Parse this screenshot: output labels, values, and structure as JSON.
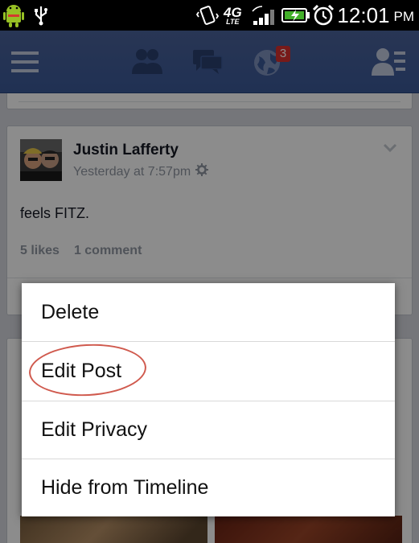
{
  "status_bar": {
    "time": "12:01",
    "ampm": "PM",
    "network_label": "4G",
    "network_sub": "LTE",
    "icons": [
      "android-icon",
      "usb-icon",
      "vibrate-icon",
      "signal-bars-icon",
      "battery-charging-icon",
      "alarm-clock-icon"
    ]
  },
  "fb_header": {
    "icons": [
      "menu-icon",
      "friend-requests-icon",
      "messages-icon",
      "notifications-globe-icon",
      "friends-list-icon"
    ],
    "notification_count": "3"
  },
  "post": {
    "author": "Justin Lafferty",
    "timestamp": "Yesterday at 7:57pm",
    "text": "feels FITZ.",
    "likes": "5 likes",
    "comments": "1 comment"
  },
  "context_menu": {
    "items": [
      {
        "label": "Delete"
      },
      {
        "label": "Edit Post",
        "highlighted": true
      },
      {
        "label": "Edit Privacy"
      },
      {
        "label": "Hide from Timeline"
      }
    ],
    "highlight_color": "#d05a4e"
  },
  "colors": {
    "fb_blue": "#3b5998",
    "badge_red": "#d9302e"
  }
}
